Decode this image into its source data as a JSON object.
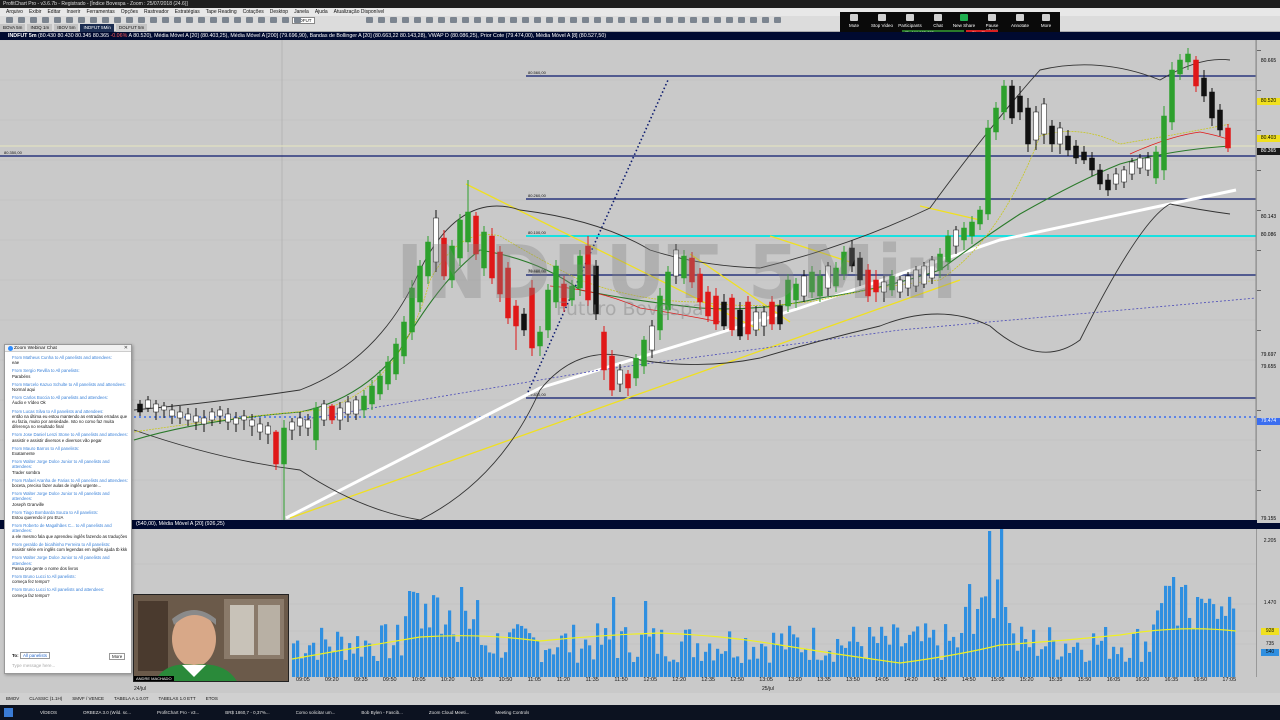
{
  "window": {
    "title": "ProfitChart Pro - v3.6.7b - Registrado - [Índice Bovespa - Zoom : 25/07/2018 (24.6)]"
  },
  "menu": [
    "Arquivo",
    "Exibir",
    "Editar",
    "Inserir",
    "Ferramentas",
    "Opções",
    "Rastreador",
    "Estratégias",
    "Tape Reading",
    "Cotações",
    "Desktop",
    "Janela",
    "Ajuda",
    "Atualização Disponível"
  ],
  "tabs": [
    {
      "label": "BOVA 5m",
      "active": false
    },
    {
      "label": "INDQ 1m",
      "active": false
    },
    {
      "label": "IBOV 5m",
      "active": false
    },
    {
      "label": "INDFUT 5Min",
      "active": true
    },
    {
      "label": "DOLFUT 5m",
      "active": false
    }
  ],
  "toolbar_symbol": "INDFUT",
  "zoom_controls": [
    {
      "label": "Mute",
      "icon": "microphone-icon"
    },
    {
      "label": "Stop Video",
      "icon": "video-camera-icon"
    },
    {
      "label": "Participants",
      "icon": "participants-icon"
    },
    {
      "label": "Chat",
      "icon": "chat-icon"
    },
    {
      "label": "New Share",
      "icon": "share-screen-icon"
    },
    {
      "label": "Pause Share",
      "icon": "pause-icon"
    },
    {
      "label": "Annotate",
      "icon": "pencil-icon"
    },
    {
      "label": "More",
      "icon": "more-icon"
    }
  ],
  "share_banner": {
    "id": "ID: 444-163-895",
    "stop": "Stop Share"
  },
  "chart_header": {
    "symbol": "INDFUT 5m",
    "quote": "(80.430  80.430  80.345  80.365  ",
    "change": "-0.06%",
    "rest": "  A 80.520), Média Móvel A [20] (80.403,25), Média Móvel A [200] (79.696,90), Bandas de Bollinger A [20] (80.663,22  80.143,28), VWAP D (80.086,25), Prior Cote (79.474,00), Média Móvel A [8] (80.527,50)"
  },
  "price_tags": [
    {
      "label": "80.665",
      "bg": "#c9c9c9",
      "fg": "#000"
    },
    {
      "label": "80.520",
      "bg": "#f0e020",
      "fg": "#000"
    },
    {
      "label": "80.403",
      "bg": "#f0e020",
      "fg": "#000"
    },
    {
      "label": "80.365",
      "bg": "#1a1a1a",
      "fg": "#fff"
    },
    {
      "label": "80.143",
      "bg": "#c9c9c9",
      "fg": "#000"
    },
    {
      "label": "80.086",
      "bg": "#c9c9c9",
      "fg": "#000"
    },
    {
      "label": "79.697",
      "bg": "#c9c9c9",
      "fg": "#000"
    },
    {
      "label": "79.655",
      "bg": "#c9c9c9",
      "fg": "#000"
    },
    {
      "label": "79.474",
      "bg": "#3b6ef0",
      "fg": "#fff"
    },
    {
      "label": "79.155",
      "bg": "#c9c9c9",
      "fg": "#000"
    }
  ],
  "line_labels": [
    "80.560,00",
    "80.260,00",
    "80.100,00",
    "79.960,00",
    "79.830,00",
    "79.480,00"
  ],
  "left_price_label": "80.350,00",
  "watermark": {
    "main": "INDFUT 5Min",
    "sub": "Futuro Bovespa"
  },
  "volume_header": "(540,00), Média Móvel A [20] (926,25)",
  "volume_axis": [
    "2.205",
    "1.470",
    "928",
    "735",
    "540"
  ],
  "time_axis": [
    "09:05",
    "09:20",
    "09:35",
    "09:50",
    "10:05",
    "10:20",
    "10:35",
    "10:50",
    "11:05",
    "11:20",
    "11:35",
    "11:50",
    "12:05",
    "12:20",
    "12:35",
    "12:50",
    "13:05",
    "13:20",
    "13:35",
    "13:50",
    "14:05",
    "14:20",
    "14:35",
    "14:50",
    "15:05",
    "15:20",
    "15:35",
    "15:50",
    "16:05",
    "16:20",
    "16:35",
    "16:50",
    "17:05"
  ],
  "date_labels": [
    "24/jul",
    "25/jul"
  ],
  "statusbar": [
    "BMOV",
    "CLASSIC (1.1H)",
    "SMVF / VENCE",
    "TABELA A 1.0.0T",
    "TABELAS 1.0 ETT",
    "ETOS"
  ],
  "chat": {
    "title": "Zoom Webinar Chat",
    "messages": [
      {
        "from": "From Matheus Cunha to All panelists and attendees:",
        "text": "eae"
      },
      {
        "from": "From Sergio Revilla to All panelists:",
        "text": "Parabéns"
      },
      {
        "from": "From Marcelo Kazuo Schulte to All panelists and attendees:",
        "text": "Normal aqui"
      },
      {
        "from": "From Carlos Boccia to All panelists and attendees:",
        "text": "Áudio e Vídeo Ok"
      },
      {
        "from": "From Lucas Silva to All panelists and attendees:",
        "text": "então na última eu estou mantendo as entradas erradas que eu fazia, muito por ansiedade. Isto no como faz muita diferença no resultado final"
      },
      {
        "from": "From Jose Daniel Lenzi Stone to All panelists and attendees:",
        "text": "assistir e assistir diversos e diversos vão pegar"
      },
      {
        "from": "From Mauro Barros to All panelists:",
        "text": "Exatamente"
      },
      {
        "from": "From Walter Jorge Dolce Junior to All panelists and attendees:",
        "text": "Trader sombra"
      },
      {
        "from": "From Rafael Aranha de Farias to All panelists and attendees:",
        "text": "boceta, preciso fazer aulas de inglês urgente..."
      },
      {
        "from": "From Walter Jorge Dolce Junior to All panelists and attendees:",
        "text": "Joseph Granville"
      },
      {
        "from": "From Tiago Bombarda Souza to All panelists:",
        "text": "Estou querendo ir pro EUA"
      },
      {
        "from": "From Roberto de Magalhães C... to All panelists and attendees:",
        "text": "a ele mesmo fala que aprendeu inglês fazendo as traduções"
      },
      {
        "from": "From geraldo de bicalhinho Ferreira to All panelists:",
        "text": "assistir série em inglês com legendas em inglês ajuda tb kkk"
      },
      {
        "from": "From Walter Jorge Dolce Junior to All panelists and attendees:",
        "text": "Passa pra gente o nome dos livros"
      },
      {
        "from": "From Bruno Lucci to All panelists:",
        "text": "começa fez tempo?"
      },
      {
        "from": "From Bruno Lucci to All panelists and attendees:",
        "text": "começa faz tempo?"
      }
    ],
    "to_label": "To:",
    "to_value": "All panelists",
    "more_label": "More",
    "input_placeholder": "Type message here..."
  },
  "webcam_label": "ANDRE MACHADO",
  "taskbar_items": [
    "VÍDEOS",
    "ORBEZA 3.0 (Wild. sc...",
    "ProfitChart Pro - v3...",
    "BR$ 1860,7 - 0,37%...",
    "Como solicitar um...",
    "Bob Bylen - Fascib...",
    "Zoom Cloud Meeti...",
    "Meeting Controls"
  ],
  "colors": {
    "up": "#2da02d",
    "down": "#e01818",
    "doji": "#111111",
    "hline": "#0b1a6e",
    "cyan": "#18e0e0",
    "trend": "#f0e020",
    "volume": "#2f8fe0",
    "vol_ma": "#f0f020",
    "sma200": "#ffffff",
    "sma20": "#c8c820",
    "bb": "#333333",
    "vwap": "#2a7a2a",
    "prior": "#3b6ef0"
  }
}
